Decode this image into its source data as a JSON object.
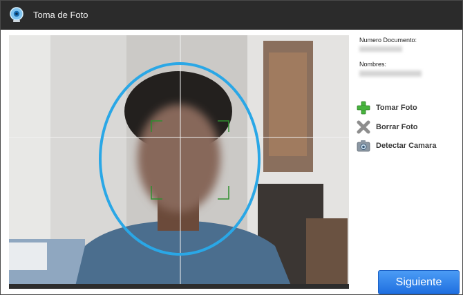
{
  "window": {
    "title": "Toma de Foto"
  },
  "info": {
    "document_label": "Numero Documento:",
    "document_value": "",
    "names_label": "Nombres:",
    "names_value": ""
  },
  "actions": [
    {
      "label": "Tomar Foto",
      "icon": "plus-icon"
    },
    {
      "label": "Borrar Foto",
      "icon": "x-icon"
    },
    {
      "label": "Detectar Camara",
      "icon": "camera-icon"
    }
  ],
  "footer": {
    "next_label": "Siguiente"
  },
  "colors": {
    "accent": "#2aa7e6",
    "face_box": "#2f8f2f",
    "titlebar": "#2b2b2b",
    "button": "#2f80ea"
  }
}
